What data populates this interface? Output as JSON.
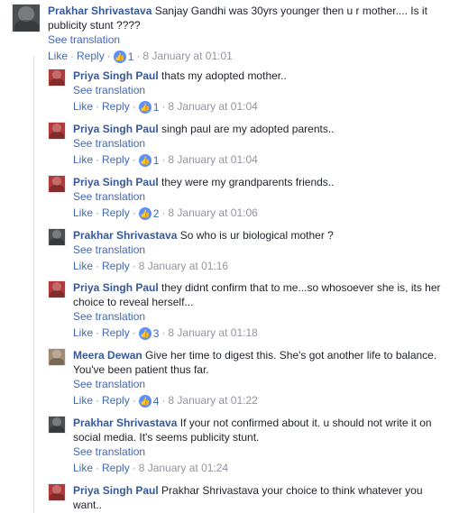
{
  "ui": {
    "see_translation": "See translation",
    "like": "Like",
    "reply": "Reply"
  },
  "comments": [
    {
      "author": "Prakhar Shrivastava",
      "text": "Sanjay Gandhi was 30yrs younger then u r mother.... Is it publicity stunt ????",
      "likes": "1",
      "time": "8 January at 01:01",
      "avatar_icon": "user-photo",
      "avatar_color": "#4a4f52"
    },
    {
      "author": "Priya Singh Paul",
      "text": "thats my adopted mother..",
      "likes": "1",
      "time": "8 January at 01:04",
      "avatar_icon": "user-photo",
      "avatar_color": "#b13b3a"
    },
    {
      "author": "Priya Singh Paul",
      "text": "singh paul are my adopted parents..",
      "likes": "1",
      "time": "8 January at 01:04",
      "avatar_icon": "user-photo",
      "avatar_color": "#b13b3a"
    },
    {
      "author": "Priya Singh Paul",
      "text": "they were my grandparents friends..",
      "likes": "2",
      "time": "8 January at 01:06",
      "avatar_icon": "user-photo",
      "avatar_color": "#b13b3a"
    },
    {
      "author": "Prakhar Shrivastava",
      "text": "So who is ur biological mother ?",
      "likes": "",
      "time": "8 January at 01:16",
      "avatar_icon": "user-photo",
      "avatar_color": "#4a4f52"
    },
    {
      "author": "Priya Singh Paul",
      "text": "they didnt confirm that to me...so whosoever she is, its her choice to reveal herself...",
      "likes": "3",
      "time": "8 January at 01:18",
      "avatar_icon": "user-photo",
      "avatar_color": "#b13b3a"
    },
    {
      "author": "Meera Dewan",
      "text": "Give her time to digest this. She's got another life to balance. You've been patient thus far.",
      "likes": "4",
      "time": "8 January at 01:22",
      "avatar_icon": "user-photo",
      "avatar_color": "#a08c74"
    },
    {
      "author": "Prakhar Shrivastava",
      "text": "If your not confirmed about it. u should not write it on social media. It's seems publicity stunt.",
      "likes": "",
      "time": "8 January at 01:24",
      "avatar_icon": "user-photo",
      "avatar_color": "#4a4f52"
    },
    {
      "author": "Priya Singh Paul",
      "text": "Prakhar Shrivastava your choice to think whatever you want..",
      "avatar_icon": "user-photo",
      "avatar_color": "#b13b3a"
    }
  ]
}
